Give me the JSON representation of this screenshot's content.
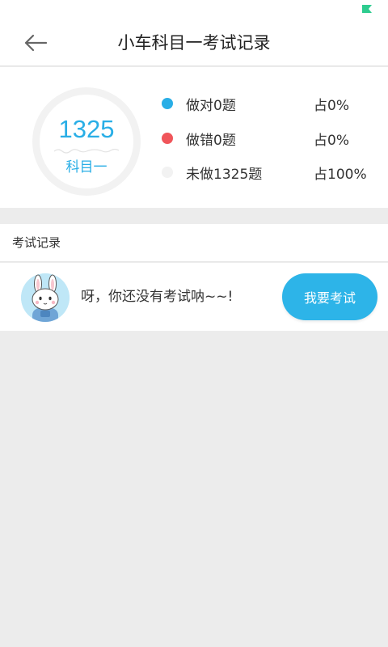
{
  "header": {
    "title": "小车科目一考试记录"
  },
  "stats": {
    "total_count": "1325",
    "subject_label": "科目一",
    "legend": [
      {
        "label": "做对0题",
        "percent": "占0%",
        "color": "#29aee6"
      },
      {
        "label": "做错0题",
        "percent": "占0%",
        "color": "#f0555a"
      },
      {
        "label": "未做1325题",
        "percent": "占100%",
        "color": "#f2f2f2"
      }
    ]
  },
  "records": {
    "section_title": "考试记录",
    "empty_message": "呀，你还没有考试呐~~!",
    "exam_button_label": "我要考试"
  },
  "colors": {
    "accent": "#29aee6",
    "status_flag": "#2ecc8f"
  }
}
